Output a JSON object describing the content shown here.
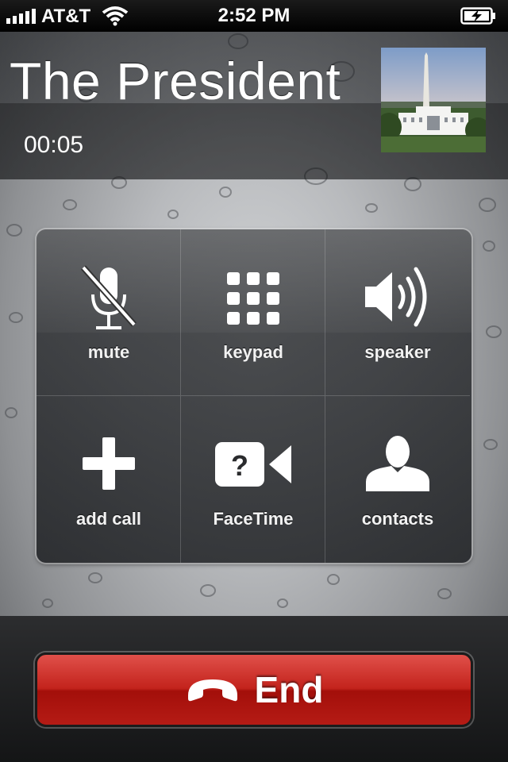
{
  "status_bar": {
    "carrier": "AT&T",
    "time": "2:52 PM"
  },
  "call": {
    "caller_name": "The President",
    "duration": "00:05"
  },
  "controls": [
    {
      "label": "mute",
      "icon": "microphone-muted-icon"
    },
    {
      "label": "keypad",
      "icon": "keypad-icon"
    },
    {
      "label": "speaker",
      "icon": "speaker-icon"
    },
    {
      "label": "add call",
      "icon": "plus-icon"
    },
    {
      "label": "FaceTime",
      "icon": "facetime-camera-icon"
    },
    {
      "label": "contacts",
      "icon": "contacts-person-icon"
    }
  ],
  "end_button": {
    "label": "End",
    "color": "#c3231c"
  }
}
